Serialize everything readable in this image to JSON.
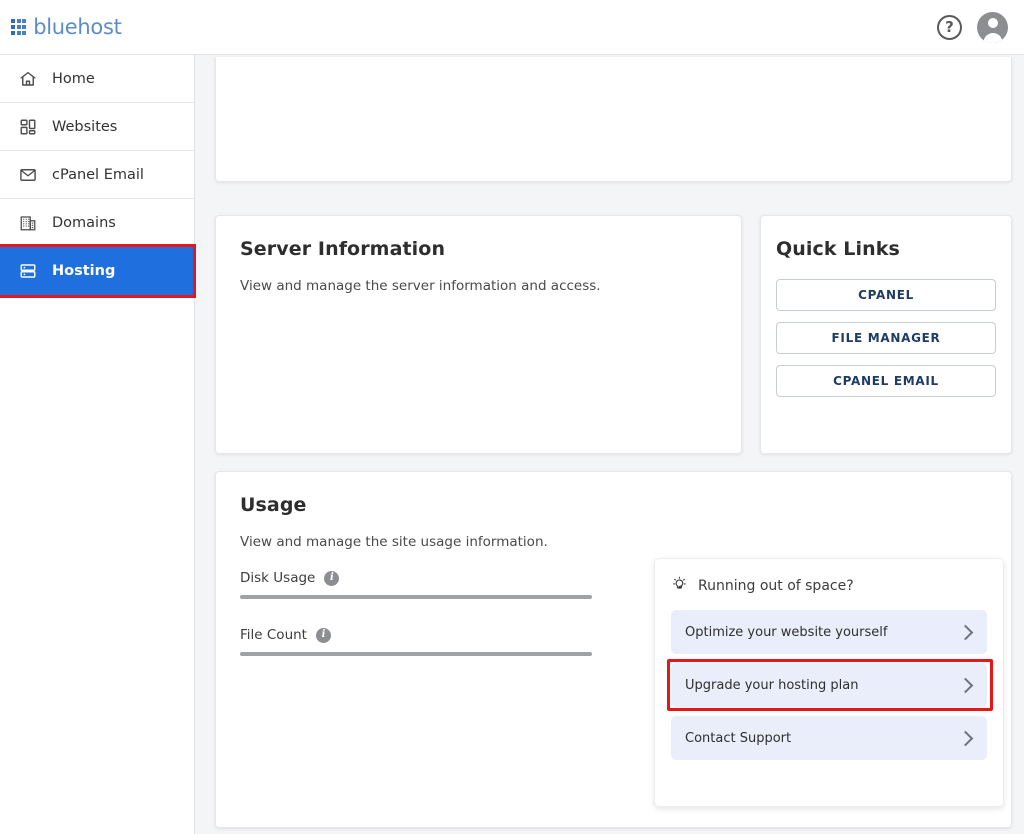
{
  "brand": {
    "name": "bluehost",
    "logo_icon": "grid-logo-icon",
    "accent": "#5b8dc8"
  },
  "topbar": {
    "help_icon": "help-circle-icon",
    "help_label": "?",
    "avatar_icon": "user-avatar-icon"
  },
  "sidebar": {
    "items": [
      {
        "label": "Home",
        "icon": "home-icon",
        "active": false
      },
      {
        "label": "Websites",
        "icon": "grid-websites-icon",
        "active": false
      },
      {
        "label": "cPanel Email",
        "icon": "envelope-icon",
        "active": false
      },
      {
        "label": "Domains",
        "icon": "building-icon",
        "active": false
      },
      {
        "label": "Hosting",
        "icon": "server-stack-icon",
        "active": true
      }
    ],
    "active_color": "#1f6fde",
    "highlight_color": "#e8161a"
  },
  "server_information": {
    "title": "Server Information",
    "description": "View and manage the server information and access."
  },
  "quick_links": {
    "title": "Quick Links",
    "buttons": [
      {
        "label": "CPANEL"
      },
      {
        "label": "FILE MANAGER"
      },
      {
        "label": "CPANEL EMAIL"
      }
    ],
    "button_text_color": "#1f3c66"
  },
  "usage": {
    "title": "Usage",
    "description": "View and manage the site usage information.",
    "meters": [
      {
        "label": "Disk Usage",
        "info_icon": "info-icon",
        "percent": 0
      },
      {
        "label": "File Count",
        "info_icon": "info-icon",
        "percent": 0
      }
    ]
  },
  "promo": {
    "icon": "lightbulb-icon",
    "title": "Running out of space?",
    "rows": [
      {
        "label": "Optimize your website yourself",
        "chevron": "chevron-right-icon",
        "highlighted": false
      },
      {
        "label": "Upgrade your hosting plan",
        "chevron": "chevron-right-icon",
        "highlighted": true
      },
      {
        "label": "Contact Support",
        "chevron": "chevron-right-icon",
        "highlighted": false
      }
    ],
    "row_background": "#e9eefa",
    "highlight_color": "#e8161a"
  }
}
